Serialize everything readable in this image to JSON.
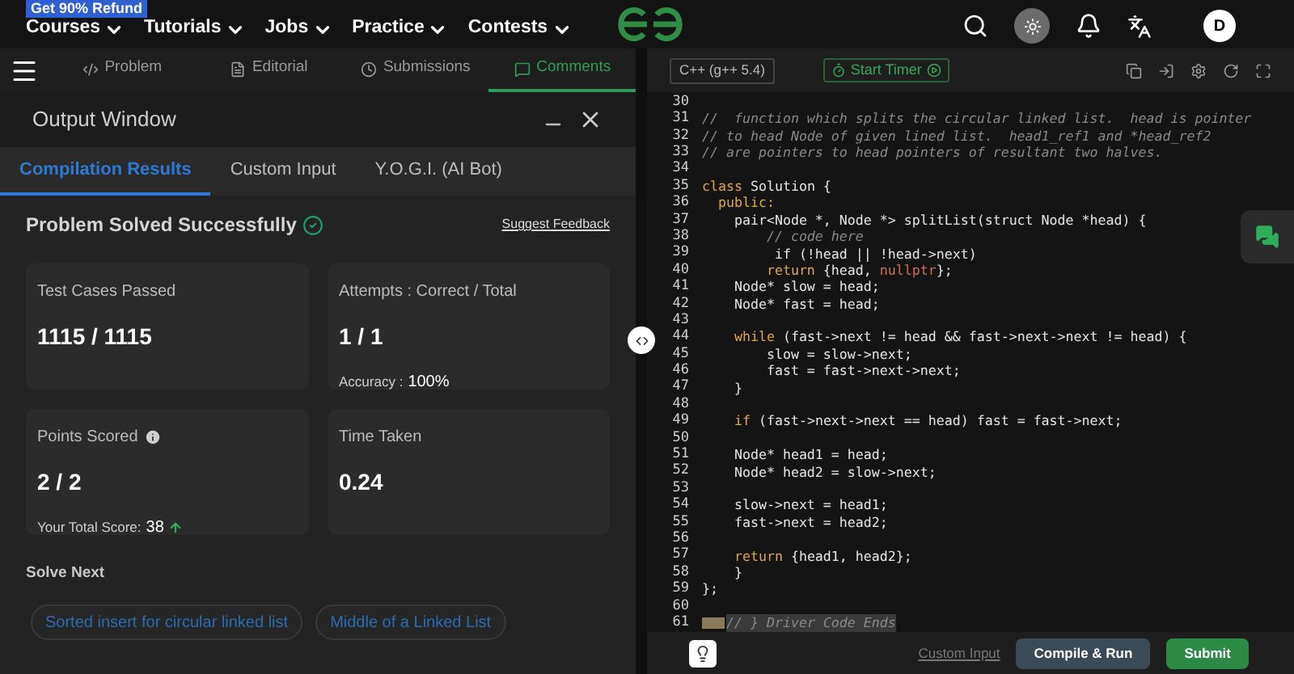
{
  "top_nav": {
    "promo_badge": "Get 90% Refund",
    "menus": [
      "Courses",
      "Tutorials",
      "Jobs",
      "Practice",
      "Contests"
    ],
    "avatar": "D"
  },
  "problem_tabs": [
    {
      "label": "Problem",
      "selected": false
    },
    {
      "label": "Editorial",
      "selected": false
    },
    {
      "label": "Submissions",
      "selected": false
    },
    {
      "label": "Comments",
      "selected": true
    }
  ],
  "output_window": {
    "title": "Output Window",
    "tabs": [
      {
        "label": "Compilation Results",
        "selected": true
      },
      {
        "label": "Custom Input",
        "selected": false
      },
      {
        "label": "Y.O.G.I. (AI Bot)",
        "selected": false
      }
    ],
    "status": "Problem Solved Successfully",
    "feedback_link": "Suggest Feedback",
    "cards": [
      {
        "kind": "basic",
        "label": "Test Cases Passed",
        "value": "1115 / 1115"
      },
      {
        "kind": "basic",
        "label": "Attempts : Correct / Total",
        "value": "1 / 1",
        "note_label": "Accuracy :",
        "note_value": "100%"
      },
      {
        "kind": "score",
        "label": "Points Scored",
        "value": "2 / 2",
        "note_label": "Your Total Score:",
        "note_value": "38"
      },
      {
        "kind": "basic",
        "label": "Time Taken",
        "value": "0.24"
      }
    ],
    "solve_next": {
      "title": "Solve Next",
      "items": [
        "Sorted insert for circular linked list",
        "Middle of a Linked List"
      ]
    }
  },
  "editor": {
    "language": "C++ (g++ 5.4)",
    "timer": "Start Timer",
    "lines": [
      {
        "number": "30"
      },
      {
        "number": "31",
        "tokens": [
          {
            "text": "//  function which splits the circular linked list.  head is pointer",
            "kind": "comment"
          }
        ]
      },
      {
        "number": "32",
        "tokens": [
          {
            "text": "// to head Node of given lined list.  head1_ref1 and *head_ref2",
            "kind": "comment"
          }
        ]
      },
      {
        "number": "33",
        "tokens": [
          {
            "text": "// are pointers to head pointers of resultant two halves.",
            "kind": "comment"
          }
        ]
      },
      {
        "number": "34"
      },
      {
        "number": "35",
        "tokens": [
          {
            "text": "class",
            "kind": "keyword"
          },
          {
            "text": " Solution {",
            "kind": "plain"
          }
        ]
      },
      {
        "number": "36",
        "tokens": [
          {
            "text": "  public:",
            "kind": "keyword"
          }
        ]
      },
      {
        "number": "37",
        "tokens": [
          {
            "text": "    pair<Node *, Node *> splitList(struct Node *head) {",
            "kind": "plain"
          }
        ]
      },
      {
        "number": "38",
        "tokens": [
          {
            "text": "        // code here",
            "kind": "comment"
          }
        ]
      },
      {
        "number": "39",
        "tokens": [
          {
            "text": "         if (!head || !head->next)",
            "kind": "plain"
          }
        ]
      },
      {
        "number": "40",
        "tokens": [
          {
            "text": "        return",
            "kind": "keyword"
          },
          {
            "text": " {head, ",
            "kind": "plain"
          },
          {
            "text": "nullptr",
            "kind": "literal"
          },
          {
            "text": "};",
            "kind": "plain"
          }
        ]
      },
      {
        "number": "41",
        "tokens": [
          {
            "text": "    Node* slow = head;",
            "kind": "plain"
          }
        ]
      },
      {
        "number": "42",
        "tokens": [
          {
            "text": "    Node* fast = head;",
            "kind": "plain"
          }
        ]
      },
      {
        "number": "43"
      },
      {
        "number": "44",
        "tokens": [
          {
            "text": "    while",
            "kind": "keyword"
          },
          {
            "text": " (fast->next != head && fast->next->next != head) {",
            "kind": "plain"
          }
        ]
      },
      {
        "number": "45",
        "tokens": [
          {
            "text": "        slow = slow->next;",
            "kind": "plain"
          }
        ]
      },
      {
        "number": "46",
        "tokens": [
          {
            "text": "        fast = fast->next->next;",
            "kind": "plain"
          }
        ]
      },
      {
        "number": "47",
        "tokens": [
          {
            "text": "    }",
            "kind": "plain"
          }
        ]
      },
      {
        "number": "48"
      },
      {
        "number": "49",
        "tokens": [
          {
            "text": "    if",
            "kind": "keyword"
          },
          {
            "text": " (fast->next->next == head) fast = fast->next;",
            "kind": "plain"
          }
        ]
      },
      {
        "number": "50"
      },
      {
        "number": "51",
        "tokens": [
          {
            "text": "    Node* head1 = head;",
            "kind": "plain"
          }
        ]
      },
      {
        "number": "52",
        "tokens": [
          {
            "text": "    Node* head2 = slow->next;",
            "kind": "plain"
          }
        ]
      },
      {
        "number": "53"
      },
      {
        "number": "54",
        "tokens": [
          {
            "text": "    slow->next = head1;",
            "kind": "plain"
          }
        ]
      },
      {
        "number": "55",
        "tokens": [
          {
            "text": "    fast->next = head2;",
            "kind": "plain"
          }
        ]
      },
      {
        "number": "56"
      },
      {
        "number": "57",
        "tokens": [
          {
            "text": "    return",
            "kind": "keyword"
          },
          {
            "text": " {head1, head2};",
            "kind": "plain"
          }
        ]
      },
      {
        "number": "58",
        "tokens": [
          {
            "text": "    }",
            "kind": "plain"
          }
        ]
      },
      {
        "number": "59",
        "tokens": [
          {
            "text": "};",
            "kind": "plain"
          }
        ]
      },
      {
        "number": "60"
      },
      {
        "number": "61",
        "folded": true,
        "tokens": [
          {
            "text": "// } Driver Code Ends",
            "kind": "comment"
          }
        ]
      }
    ]
  },
  "footer": {
    "custom_input": "Custom Input",
    "compile_run": "Compile & Run",
    "submit": "Submit"
  }
}
